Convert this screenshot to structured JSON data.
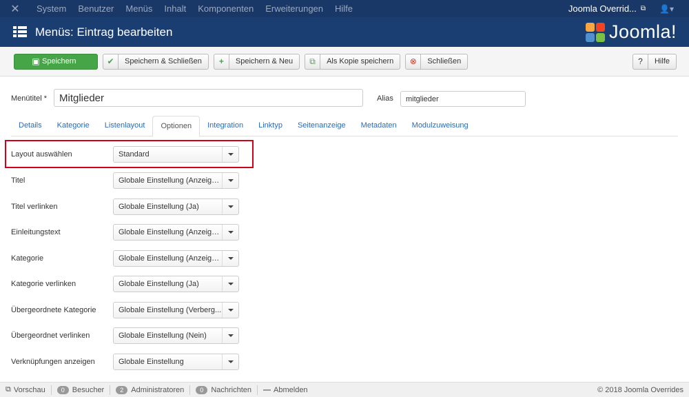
{
  "topnav": {
    "menu": [
      "System",
      "Benutzer",
      "Menüs",
      "Inhalt",
      "Komponenten",
      "Erweiterungen",
      "Hilfe"
    ],
    "site_link": "Joomla Overrid...",
    "icons": [
      "joomla-icon",
      "external-link-icon",
      "user-icon"
    ]
  },
  "header": {
    "title": "Menüs: Eintrag bearbeiten",
    "brand": "Joomla!",
    "brand_colors": [
      "#f9a541",
      "#f44321",
      "#5091cd",
      "#7ac143"
    ]
  },
  "toolbar": {
    "save": "Speichern",
    "save_close": "Speichern & Schließen",
    "save_new": "Speichern & Neu",
    "save_copy": "Als Kopie speichern",
    "close": "Schließen",
    "help": "Hilfe"
  },
  "form": {
    "title_label": "Menütitel *",
    "title_value": "Mitglieder",
    "alias_label": "Alias",
    "alias_value": "mitglieder"
  },
  "tabs": [
    "Details",
    "Kategorie",
    "Listenlayout",
    "Optionen",
    "Integration",
    "Linktyp",
    "Seitenanzeige",
    "Metadaten",
    "Modulzuweisung"
  ],
  "active_tab": "Optionen",
  "options": [
    {
      "label": "Layout auswählen",
      "value": "Standard"
    },
    {
      "label": "Titel",
      "value": "Globale Einstellung (Anzeigen)"
    },
    {
      "label": "Titel verlinken",
      "value": "Globale Einstellung (Ja)"
    },
    {
      "label": "Einleitungstext",
      "value": "Globale Einstellung (Anzeigen)"
    },
    {
      "label": "Kategorie",
      "value": "Globale Einstellung (Anzeigen)"
    },
    {
      "label": "Kategorie verlinken",
      "value": "Globale Einstellung (Ja)"
    },
    {
      "label": "Übergeordnete Kategorie",
      "value": "Globale Einstellung (Verberg..."
    },
    {
      "label": "Übergeordnet verlinken",
      "value": "Globale Einstellung (Nein)"
    },
    {
      "label": "Verknüpfungen anzeigen",
      "value": "Globale Einstellung"
    }
  ],
  "status": {
    "preview": "Vorschau",
    "visitors_count": "0",
    "visitors": "Besucher",
    "admins_count": "2",
    "admins": "Administratoren",
    "messages_count": "0",
    "messages": "Nachrichten",
    "logout": "Abmelden",
    "copyright": "© 2018 Joomla Overrides"
  },
  "colors": {
    "topnav": "#1a3867",
    "header": "#1b3e72",
    "save": "#46a546",
    "highlight": "#d0021b",
    "link": "#2a69b8"
  }
}
